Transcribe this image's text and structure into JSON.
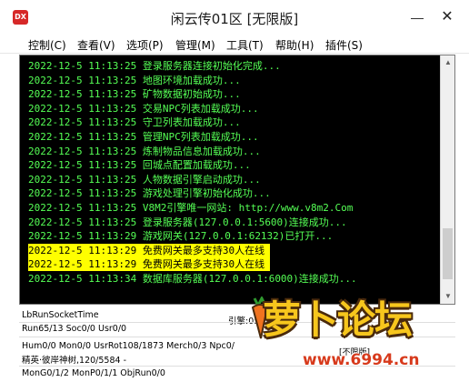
{
  "window": {
    "title": "闲云传01区 [无限版]",
    "icon_label": "DX",
    "min_glyph": "—",
    "close_glyph": "✕"
  },
  "menu": [
    {
      "label": "控制(C)"
    },
    {
      "label": "查看(V)"
    },
    {
      "label": "选项(P)"
    },
    {
      "label": "管理(M)"
    },
    {
      "label": "工具(T)"
    },
    {
      "label": "帮助(H)"
    },
    {
      "label": "插件(S)"
    }
  ],
  "log": [
    {
      "time": "2022-12-5 11:13:25",
      "message": "登录服务器连接初始化完成...",
      "highlight": false
    },
    {
      "time": "2022-12-5 11:13:25",
      "message": "地图环境加载成功...",
      "highlight": false
    },
    {
      "time": "2022-12-5 11:13:25",
      "message": "矿物数据初始成功...",
      "highlight": false
    },
    {
      "time": "2022-12-5 11:13:25",
      "message": "交易NPC列表加载成功...",
      "highlight": false
    },
    {
      "time": "2022-12-5 11:13:25",
      "message": "守卫列表加载成功...",
      "highlight": false
    },
    {
      "time": "2022-12-5 11:13:25",
      "message": "管理NPC列表加载成功...",
      "highlight": false
    },
    {
      "time": "2022-12-5 11:13:25",
      "message": "炼制物品信息加载成功...",
      "highlight": false
    },
    {
      "time": "2022-12-5 11:13:25",
      "message": "回城点配置加载成功...",
      "highlight": false
    },
    {
      "time": "2022-12-5 11:13:25",
      "message": "人物数据引擎启动成功...",
      "highlight": false
    },
    {
      "time": "2022-12-5 11:13:25",
      "message": "游戏处理引擎初始化成功...",
      "highlight": false
    },
    {
      "time": "2022-12-5 11:13:25",
      "message": "V8M2引擎唯一网站: http://www.v8m2.Com",
      "highlight": false
    },
    {
      "time": "2022-12-5 11:13:25",
      "message": "登录服务器(127.0.0.1:5600)连接成功...",
      "highlight": false
    },
    {
      "time": "2022-12-5 11:13:29",
      "message": "游戏网关(127.0.0.1:62132)已打开...",
      "highlight": false
    },
    {
      "time": "2022-12-5 11:13:29",
      "message": "免费网关最多支持30人在线",
      "highlight": true
    },
    {
      "time": "2022-12-5 11:13:29",
      "message": "免费网关最多支持30人在线",
      "highlight": true
    },
    {
      "time": "2022-12-5 11:13:34",
      "message": "数据库服务器(127.0.0.1:6000)连接成功...",
      "highlight": false
    }
  ],
  "status": {
    "line1": "LbRunSocketTime",
    "line2": "Run65/13 Soc0/0 Usr0/0",
    "engine_label": "引擎:0:0",
    "line3": "Hum0/0 Mon0/0 UsrRot108/1873 Merch0/3 Npc0/",
    "line4": "精英·彼岸神树,120/5584 -",
    "line5": "MonG0/1/2 MonP0/1/1 ObjRun0/0",
    "extra": "[不限版]"
  },
  "watermark": {
    "title": "萝卜论坛",
    "url": "www.6994.cn"
  },
  "scrollbar": {
    "up_glyph": "▲",
    "down_glyph": "▼"
  }
}
